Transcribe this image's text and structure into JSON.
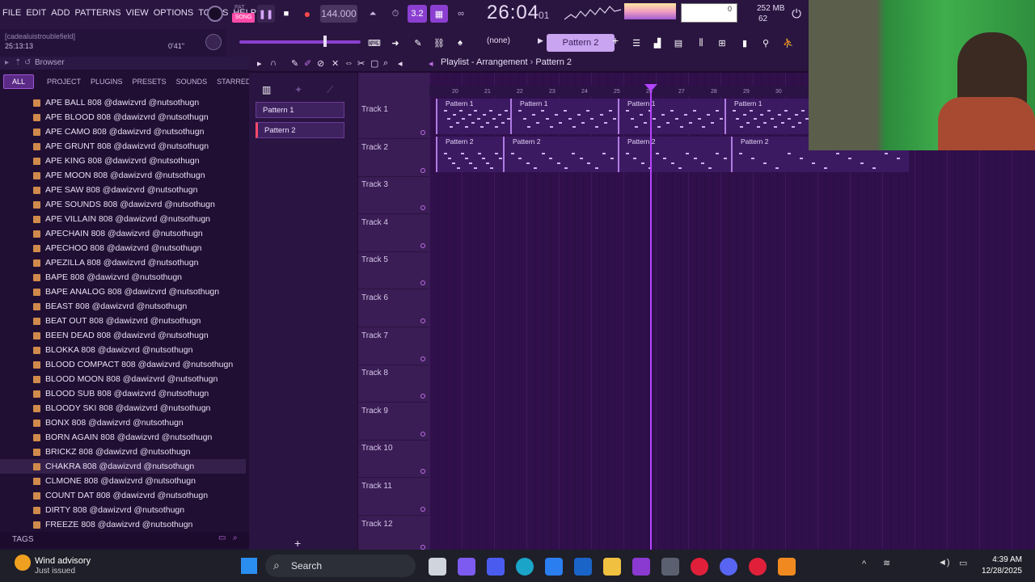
{
  "menu": [
    "FILE",
    "EDIT",
    "ADD",
    "PATTERNS",
    "VIEW",
    "OPTIONS",
    "TOOLS",
    "HELP"
  ],
  "transport": {
    "mode_pat": "PAT",
    "mode_song": "SONG",
    "tempo": "144.000",
    "time": "26:04",
    "time_small": "01",
    "snap": "3.2"
  },
  "cpu": {
    "mem": "252 MB",
    "voices": "62",
    "cpu": "0"
  },
  "hint": {
    "line1": "[cadealuistroublefield]",
    "line2": "25:13:13",
    "pos": "0'41\""
  },
  "toolbar2": {
    "snap_label": "(none)",
    "pattern": "Pattern 2"
  },
  "browser": {
    "title": "Browser",
    "tabs": [
      "ALL",
      "PROJECT",
      "PLUGINS",
      "PRESETS",
      "SOUNDS",
      "STARRED"
    ],
    "items": [
      "APE BALL 808 @dawizvrd @nutsothugn",
      "APE BLOOD 808 @dawizvrd @nutsothugn",
      "APE CAMO 808 @dawizvrd @nutsothugn",
      "APE GRUNT 808 @dawizvrd @nutsothugn",
      "APE KING 808 @dawizvrd @nutsothugn",
      "APE MOON 808 @dawizvrd @nutsothugn",
      "APE SAW 808 @dawizvrd @nutsothugn",
      "APE SOUNDS 808 @dawizvrd @nutsothugn",
      "APE VILLAIN 808 @dawizvrd @nutsothugn",
      "APECHAIN 808 @dawizvrd @nutsothugn",
      "APECHOO 808 @dawizvrd @nutsothugn",
      "APEZILLA 808 @dawizvrd @nutsothugn",
      "BAPE 808 @dawizvrd @nutsothugn",
      "BAPE ANALOG 808 @dawizvrd @nutsothugn",
      "BEAST 808 @dawizvrd @nutsothugn",
      "BEAT OUT 808 @dawizvrd @nutsothugn",
      "BEEN DEAD 808 @dawizvrd @nutsothugn",
      "BLOKKA 808 @dawizvrd @nutsothugn",
      "BLOOD COMPACT 808 @dawizvrd @nutsothugn",
      "BLOOD MOON 808 @dawizvrd @nutsothugn",
      "BLOOD SUB 808 @dawizvrd @nutsothugn",
      "BLOODY SKI 808 @dawizvrd @nutsothugn",
      "BONX 808 @dawizvrd @nutsothugn",
      "BORN AGAIN 808 @dawizvrd @nutsothugn",
      "BRICKZ 808 @dawizvrd @nutsothugn",
      "CHAKRA 808 @dawizvrd @nutsothugn",
      "CLMONE 808 @dawizvrd @nutsothugn",
      "COUNT DAT 808 @dawizvrd @nutsothugn",
      "DIRTY 808 @dawizvrd @nutsothugn",
      "FREEZE 808 @dawizvrd @nutsothugn"
    ],
    "selected_index": 25,
    "tags_label": "TAGS"
  },
  "playlist": {
    "title": "Playlist - Arrangement",
    "separator": "›",
    "pattern": "Pattern 2",
    "patterns": [
      "Pattern 1",
      "Pattern 2"
    ],
    "tracks": [
      "Track 1",
      "Track 2",
      "Track 3",
      "Track 4",
      "Track 5",
      "Track 6",
      "Track 7",
      "Track 8",
      "Track 9",
      "Track 10",
      "Track 11",
      "Track 12"
    ],
    "ruler": [
      "20",
      "21",
      "22",
      "23",
      "24",
      "25",
      "26",
      "27",
      "28",
      "29",
      "30"
    ],
    "clips_track1": [
      "Pattern 1",
      "Pattern 1",
      "Pattern 1",
      "Pattern 1"
    ],
    "clips_track2": [
      "Pattern 2",
      "Pattern 2",
      "Pattern 2",
      "Pattern 2"
    ]
  },
  "taskbar": {
    "weather_title": "Wind advisory",
    "weather_sub": "Just issued",
    "search": "Search",
    "time": "4:39 AM",
    "date": "12/28/2025"
  },
  "colors": {
    "accent": "#b444ff",
    "bg": "#300f4b"
  }
}
